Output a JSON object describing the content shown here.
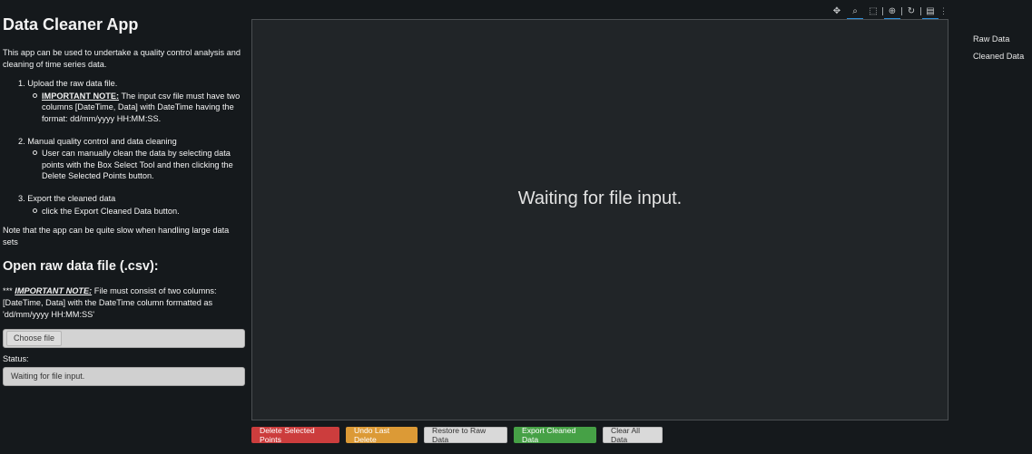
{
  "app": {
    "title": "Data Cleaner App",
    "intro": "This app can be used to undertake a quality control analysis and cleaning of time series data."
  },
  "steps": [
    {
      "title": "1. Upload the raw data file.",
      "sub_label": "IMPORTANT NOTE:",
      "sub_text": " The input csv file must have two columns [DateTime, Data] with DateTime having the format: dd/mm/yyyy HH:MM:SS."
    },
    {
      "title": "2. Manual quality control and data cleaning",
      "sub_text": "User can manually clean the data by selecting data points with the Box Select Tool and then clicking the Delete Selected Points button."
    },
    {
      "title": "3. Export the cleaned data",
      "sub_text": "click the Export Cleaned Data button."
    }
  ],
  "note": "Note that the app can be quite slow when handling large data sets",
  "upload": {
    "heading": "Open raw data file (.csv):",
    "note_prefix": "***",
    "note_label": "IMPORTANT NOTE:",
    "note_text": " File must consist of two columns: [DateTime, Data] with the DateTime column formatted as 'dd/mm/yyyy HH:MM:SS'",
    "choose_label": "Choose file"
  },
  "status": {
    "label": "Status:",
    "value": "Waiting for file input."
  },
  "plot": {
    "message": "Waiting for file input."
  },
  "toolbar": {
    "tools": [
      {
        "name": "pan-icon",
        "glyph": "✥",
        "active": false
      },
      {
        "name": "box-zoom-icon",
        "glyph": "⌕",
        "active": true
      },
      {
        "name": "box-select-icon",
        "glyph": "⬚",
        "active": false
      },
      {
        "name": "lasso-select-icon",
        "glyph": "⊕",
        "active": true
      },
      {
        "name": "reset-icon",
        "glyph": "↻",
        "active": false
      },
      {
        "name": "hover-icon",
        "glyph": "▤",
        "active": true
      }
    ]
  },
  "legend": {
    "items": [
      "Raw Data",
      "Cleaned Data"
    ]
  },
  "buttons": {
    "delete": "Delete Selected Points",
    "undo": "Undo Last Delete",
    "restore": "Restore to Raw Data",
    "export": "Export Cleaned Data",
    "clear": "Clear All Data"
  }
}
